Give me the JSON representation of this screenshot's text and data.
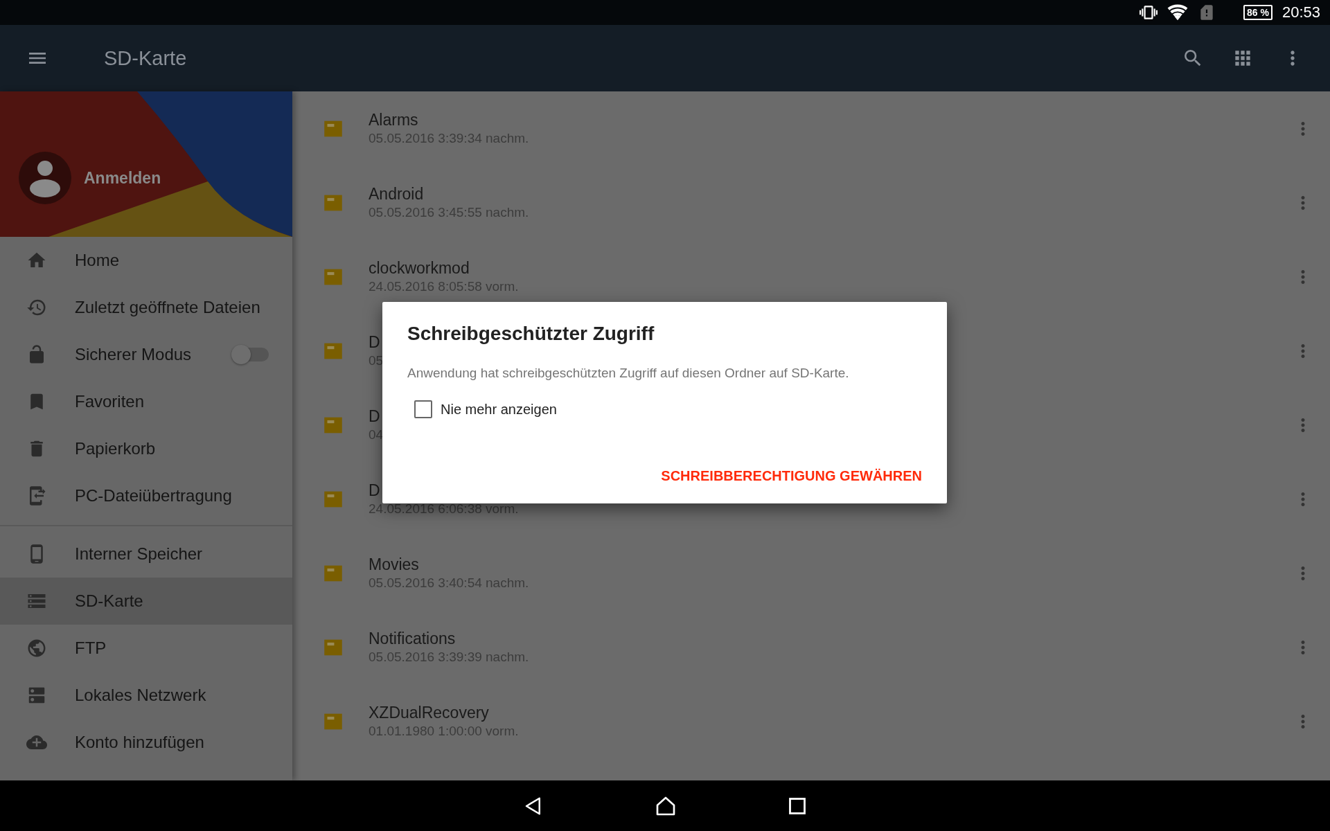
{
  "status_bar": {
    "battery": "86 %",
    "time": "20:53"
  },
  "app_bar": {
    "title": "SD-Karte"
  },
  "drawer": {
    "account": "Anmelden",
    "items": [
      {
        "label": "Home",
        "kind": "link",
        "selected": false
      },
      {
        "label": "Zuletzt geöffnete Dateien",
        "kind": "link",
        "selected": false
      },
      {
        "label": "Sicherer Modus",
        "kind": "toggle",
        "selected": false,
        "on": false
      },
      {
        "label": "Favoriten",
        "kind": "link",
        "selected": false
      },
      {
        "label": "Papierkorb",
        "kind": "link",
        "selected": false
      },
      {
        "label": "PC-Dateiübertragung",
        "kind": "link",
        "selected": false
      }
    ],
    "locations": [
      {
        "label": "Interner Speicher",
        "selected": false
      },
      {
        "label": "SD-Karte",
        "selected": true
      },
      {
        "label": "FTP",
        "selected": false
      },
      {
        "label": "Lokales Netzwerk",
        "selected": false
      },
      {
        "label": "Konto hinzufügen",
        "selected": false
      }
    ]
  },
  "files": [
    {
      "name": "Alarms",
      "date": "05.05.2016 3:39:34 nachm."
    },
    {
      "name": "Android",
      "date": "05.05.2016 3:45:55 nachm."
    },
    {
      "name": "clockworkmod",
      "date": "24.05.2016 8:05:58 vorm."
    },
    {
      "name": "D",
      "date": "05"
    },
    {
      "name": "D",
      "date": "04"
    },
    {
      "name": "D",
      "date": "24.05.2016 6:06:38 vorm."
    },
    {
      "name": "Movies",
      "date": "05.05.2016 3:40:54 nachm."
    },
    {
      "name": "Notifications",
      "date": "05.05.2016 3:39:39 nachm."
    },
    {
      "name": "XZDualRecovery",
      "date": "01.01.1980 1:00:00 vorm."
    }
  ],
  "dialog": {
    "title": "Schreibgeschützter Zugriff",
    "message": "Anwendung hat schreibgeschützten Zugriff auf diesen Ordner auf SD-Karte.",
    "checkbox": {
      "label": "Nie mehr anzeigen",
      "checked": false
    },
    "button": "SCHREIBBERECHTIGUNG GEWÄHREN"
  }
}
